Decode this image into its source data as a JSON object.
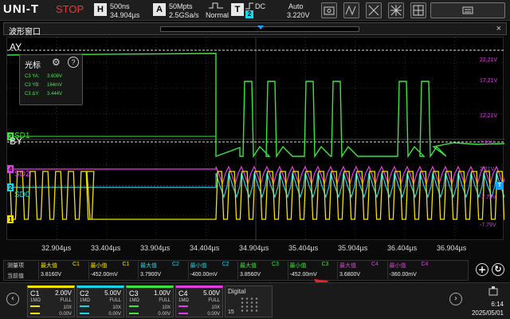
{
  "top_bar": {
    "brand": "UNI-T",
    "run_state": "STOP",
    "horizontal_key": "H",
    "timebase": "500ns",
    "sample_rate": "34.904µs",
    "acquire_key": "A",
    "memory_depth": "50Mpts",
    "acq_rate": "2.5GSa/s",
    "acq_mode": "Normal",
    "trigger_key": "T",
    "trigger_coupling": "DC",
    "trigger_source": "2",
    "trigger_mode": "Auto",
    "trigger_level": "3.220V"
  },
  "window": {
    "title": "波形窗口",
    "close": "×"
  },
  "cursor_panel": {
    "title": "光标",
    "rows": [
      {
        "label": "C3 YA:",
        "value": "3.608V"
      },
      {
        "label": "C3 YB:",
        "value": "164mV"
      },
      {
        "label": "C3 ΔY:",
        "value": "3.444V"
      }
    ]
  },
  "plot_labels": {
    "cursor_a": "AY",
    "cursor_b": "BY",
    "sd1": "SD1",
    "sd2": "SD2",
    "sd0": "SD0",
    "right_axis": [
      "22.21V",
      "17.21V",
      "12.21V",
      "7.21V",
      "2.21V",
      "-2.79V",
      "-7.79V"
    ],
    "t_marker": "T"
  },
  "time_axis": [
    "32.904µs",
    "33.404µs",
    "33.904µs",
    "34.404µs",
    "34.904µs",
    "35.404µs",
    "35.904µs",
    "36.404µs",
    "36.904µs"
  ],
  "measurements": {
    "row_labels": [
      "测量项",
      "当前值"
    ],
    "items": [
      {
        "name": "最大值",
        "ch": "C1",
        "value": "3.8160V",
        "color": "#f3e200"
      },
      {
        "name": "最小值",
        "ch": "C1",
        "value": "-452.00mV",
        "color": "#f3e200"
      },
      {
        "name": "最大值",
        "ch": "C2",
        "value": "3.7900V",
        "color": "#19d5e8"
      },
      {
        "name": "最小值",
        "ch": "C2",
        "value": "-400.00mV",
        "color": "#19d5e8"
      },
      {
        "name": "最大值",
        "ch": "C3",
        "value": "3.8560V",
        "color": "#3ee33e"
      },
      {
        "name": "最小值",
        "ch": "C3",
        "value": "-452.00mV",
        "color": "#3ee33e"
      },
      {
        "name": "最大值",
        "ch": "C4",
        "value": "3.6800V",
        "color": "#e23ce6"
      },
      {
        "name": "最小值",
        "ch": "C4",
        "value": "-360.00mV",
        "color": "#e23ce6"
      }
    ]
  },
  "channels": [
    {
      "name": "C1",
      "volts": "2.00V",
      "color": "#f3e200",
      "impedance": "1MΩ",
      "bw": "FULL",
      "probe": "10X",
      "offset": "0.00V"
    },
    {
      "name": "C2",
      "volts": "5.00V",
      "color": "#19d5e8",
      "impedance": "1MΩ",
      "bw": "FULL",
      "probe": "10X",
      "offset": "0.00V"
    },
    {
      "name": "C3",
      "volts": "1.00V",
      "color": "#3ee33e",
      "impedance": "1MΩ",
      "bw": "FULL",
      "probe": "10X",
      "offset": "0.00V"
    },
    {
      "name": "C4",
      "volts": "5.00V",
      "color": "#e23ce6",
      "impedance": "1MΩ",
      "bw": "FULL",
      "probe": "10X",
      "offset": "0.00V"
    }
  ],
  "digital": {
    "label": "Digital",
    "count": "15"
  },
  "clock": {
    "time": "6:14",
    "date": "2025/05/01"
  },
  "colors": {
    "c1": "#f3e200",
    "c2": "#19d5e8",
    "c3": "#3ee33e",
    "c4": "#e23ce6",
    "arrow": "#e8241c"
  },
  "icons": [
    "settings-gear-icon",
    "help-icon",
    "add-icon",
    "refresh-icon",
    "nav-left-icon",
    "nav-right-icon",
    "usb-icon"
  ]
}
